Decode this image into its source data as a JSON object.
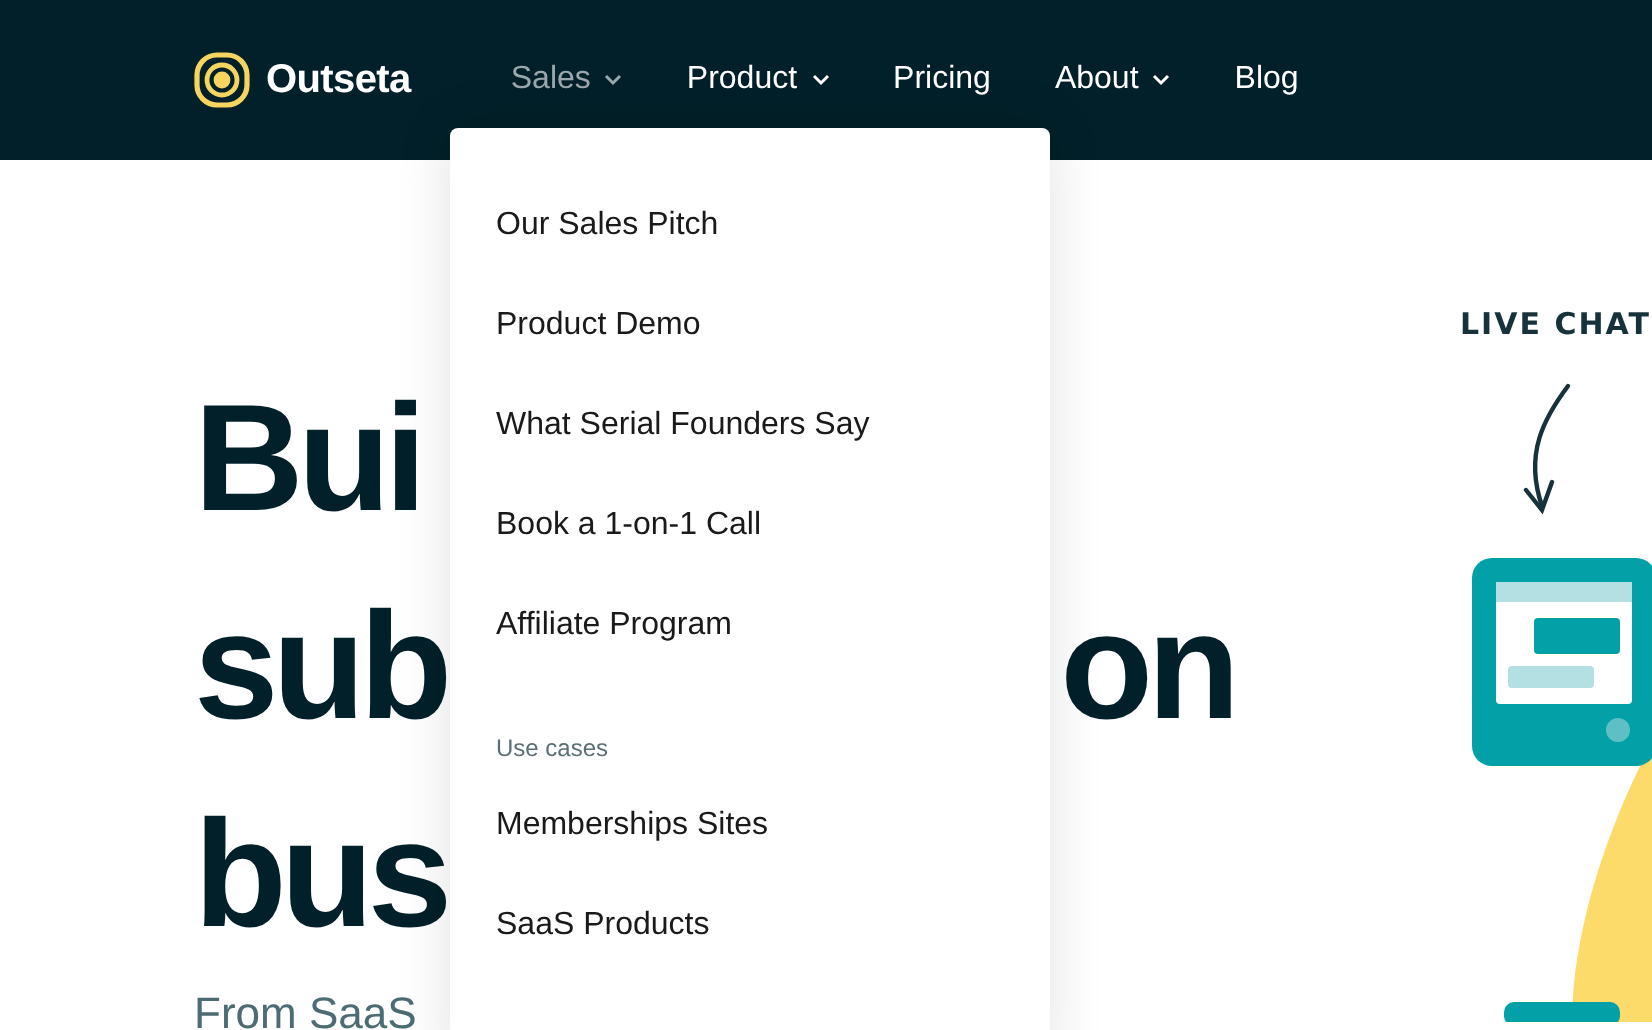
{
  "logo": {
    "text": "Outseta"
  },
  "nav": [
    {
      "label": "Sales",
      "has_menu": true,
      "selected": true
    },
    {
      "label": "Product",
      "has_menu": true,
      "selected": false
    },
    {
      "label": "Pricing",
      "has_menu": false,
      "selected": false
    },
    {
      "label": "About",
      "has_menu": true,
      "selected": false
    },
    {
      "label": "Blog",
      "has_menu": false,
      "selected": false
    }
  ],
  "dropdown": {
    "items": [
      {
        "kind": "link",
        "label": "Our Sales Pitch"
      },
      {
        "kind": "link",
        "label": "Product Demo"
      },
      {
        "kind": "link",
        "label": "What Serial Founders Say"
      },
      {
        "kind": "link",
        "label": "Book a 1-on-1 Call"
      },
      {
        "kind": "link",
        "label": "Affiliate Program"
      },
      {
        "kind": "heading",
        "label": "Use cases"
      },
      {
        "kind": "link",
        "label": "Memberships Sites"
      },
      {
        "kind": "link",
        "label": "SaaS Products"
      }
    ]
  },
  "hero": {
    "heading_lines": [
      [
        "Bui"
      ],
      [
        "sub",
        "on"
      ],
      [
        "bus"
      ]
    ],
    "subtitle": "From SaaS"
  },
  "illustration": {
    "caption": "LIVE CHAT"
  }
}
